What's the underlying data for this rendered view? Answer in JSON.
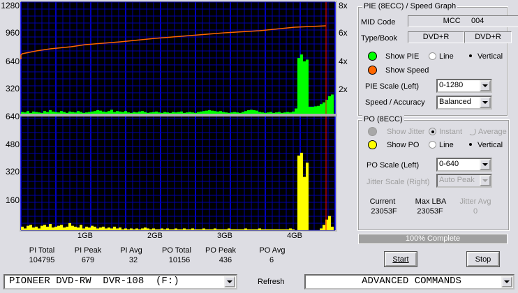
{
  "graph": {
    "left_ticks_top": [
      "1280",
      "960",
      "640",
      "320"
    ],
    "right_ticks": [
      "8x",
      "6x",
      "4x",
      "2x"
    ],
    "left_ticks_bottom": [
      "640",
      "480",
      "320",
      "160"
    ],
    "x_ticks": [
      "1GB",
      "2GB",
      "3GB",
      "4GB"
    ]
  },
  "chart_data": [
    {
      "type": "bar",
      "panel": "top",
      "series": [
        {
          "kind": "bar",
          "axis": "left",
          "color": "#00ff00",
          "x_start_gb": 0,
          "x_step_gb": 0.04,
          "values": [
            20,
            15,
            30,
            10,
            25,
            20,
            15,
            10,
            30,
            20,
            40,
            25,
            20,
            15,
            30,
            20,
            10,
            25,
            20,
            15,
            30,
            20,
            10,
            15,
            20,
            25,
            30,
            40,
            35,
            25,
            20,
            30,
            45,
            20,
            30,
            25,
            20,
            30,
            15,
            10,
            20,
            15,
            25,
            30,
            20,
            10,
            15,
            20,
            25,
            15,
            10,
            20,
            15,
            10,
            20,
            15,
            20,
            25,
            10,
            15,
            20,
            15,
            10,
            20,
            25,
            30,
            35,
            40,
            35,
            30,
            25,
            30,
            20,
            15,
            10,
            15,
            20,
            15,
            10,
            20,
            30,
            40,
            45,
            40,
            35,
            20,
            15,
            10,
            15,
            20,
            10,
            15,
            20,
            10,
            15,
            20,
            15,
            25,
            60,
            640,
            679,
            600,
            620,
            80,
            80,
            85,
            90,
            110,
            130,
            160,
            200,
            220
          ]
        },
        {
          "kind": "line",
          "axis": "right",
          "color": "#ff6600",
          "name": "Speed",
          "x_gb": [
            0,
            0.05,
            0.1,
            0.3,
            0.5,
            0.8,
            1.0,
            1.5,
            2.0,
            2.5,
            3.0,
            3.5,
            4.0,
            4.45
          ],
          "values": [
            3.9,
            4.2,
            4.3,
            4.5,
            4.65,
            4.8,
            4.95,
            5.15,
            5.4,
            5.6,
            5.8,
            5.95,
            6.2,
            6.3
          ]
        }
      ],
      "ylim_left": [
        0,
        1280
      ],
      "ylim_right": [
        0,
        8
      ],
      "xlim_gb": [
        -0.08,
        4.6
      ],
      "grid": true
    },
    {
      "type": "bar",
      "panel": "bottom",
      "series": [
        {
          "kind": "bar",
          "axis": "left",
          "color": "#ffff00",
          "x_start_gb": 0,
          "x_step_gb": 0.04,
          "values": [
            20,
            10,
            25,
            30,
            15,
            20,
            10,
            25,
            30,
            20,
            35,
            15,
            20,
            25,
            30,
            15,
            20,
            40,
            25,
            20,
            15,
            30,
            10,
            20,
            15,
            25,
            20,
            10,
            15,
            20,
            10,
            15,
            10,
            20,
            10,
            15,
            5,
            10,
            5,
            10,
            5,
            10,
            5,
            10,
            15,
            10,
            5,
            10,
            5,
            5,
            10,
            5,
            10,
            5,
            5,
            10,
            5,
            5,
            10,
            5,
            5,
            10,
            5,
            5,
            5,
            10,
            5,
            5,
            5,
            10,
            5,
            5,
            5,
            5,
            10,
            5,
            5,
            5,
            5,
            5,
            10,
            5,
            5,
            5,
            5,
            10,
            5,
            5,
            5,
            5,
            5,
            5,
            5,
            5,
            5,
            5,
            10,
            5,
            0,
            420,
            436,
            300,
            380,
            0,
            0,
            0,
            0,
            10,
            30,
            60,
            80,
            20
          ]
        }
      ],
      "ylim_left": [
        0,
        640
      ],
      "xlim_gb": [
        -0.08,
        4.6
      ],
      "grid": true,
      "marker_gb": 4.45
    }
  ],
  "stats": [
    {
      "label": "PI Total",
      "value": "104795"
    },
    {
      "label": "PI Peak",
      "value": "679"
    },
    {
      "label": "PI Avg",
      "value": "32"
    },
    {
      "label": "PO Total",
      "value": "10156"
    },
    {
      "label": "PO Peak",
      "value": "436"
    },
    {
      "label": "PO Avg",
      "value": "6"
    }
  ],
  "pie": {
    "title": "PIE (8ECC) / Speed Graph",
    "mid_label": "MID Code",
    "mid_value": "MCC     004",
    "type_label": "Type/Book",
    "type_value": "DVD+R",
    "book_value": "DVD+R",
    "show_pie": "Show PIE",
    "show_speed": "Show Speed",
    "line": "Line",
    "vertical": "Vertical",
    "scale_label": "PIE Scale (Left)",
    "scale_value": "0-1280",
    "accuracy_label": "Speed / Accuracy",
    "accuracy_value": "Balanced",
    "pie_color": "#00ff00",
    "speed_color": "#ff6600"
  },
  "po": {
    "title": "PO (8ECC)",
    "show_jitter": "Show Jitter",
    "instant": "Instant",
    "average": "Average",
    "show_po": "Show PO",
    "line": "Line",
    "vertical": "Vertical",
    "scale_label": "PO Scale (Left)",
    "scale_value": "0-640",
    "jitter_scale_label": "Jitter Scale (Right)",
    "jitter_scale_value": "Auto Peak",
    "current_label": "Current",
    "current_value": "23053F",
    "maxlba_label": "Max LBA",
    "maxlba_value": "23053F",
    "jitter_avg_label": "Jitter Avg",
    "jitter_avg_value": "0",
    "po_color": "#ffff00"
  },
  "progress": {
    "text": "100% Complete",
    "percent": 100
  },
  "buttons": {
    "start": "Start",
    "stop": "Stop",
    "refresh": "Refresh"
  },
  "drive": "PIONEER DVD-RW  DVR-108  (F:)",
  "advanced": "ADVANCED COMMANDS"
}
